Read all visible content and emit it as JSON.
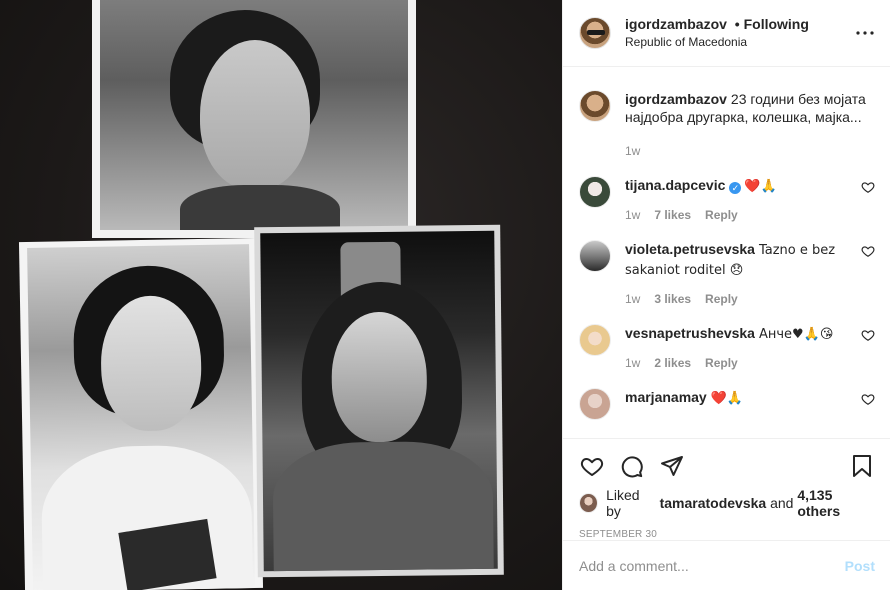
{
  "post": {
    "username": "igordzambazov",
    "follow_status": "• Following",
    "location": "Republic of Macedonia",
    "photo_alt": ""
  },
  "caption": {
    "username": "igordzambazov",
    "text": "23 години без мојата најдобра другарка, колешка, мајка...",
    "time": "1w"
  },
  "comments": [
    {
      "username": "tijana.dapcevic",
      "verified": true,
      "text": "❤️🙏",
      "time": "1w",
      "likes": "7 likes",
      "reply": "Reply"
    },
    {
      "username": "violeta.petrusevska",
      "verified": false,
      "text": "Tazno e bez sakaniot roditel 😞",
      "time": "1w",
      "likes": "3 likes",
      "reply": "Reply"
    },
    {
      "username": "vesnapetrushevska",
      "verified": false,
      "text": "Анче♥🙏😘",
      "time": "1w",
      "likes": "2 likes",
      "reply": "Reply"
    },
    {
      "username": "marjanamay",
      "verified": false,
      "text": "❤️🙏",
      "time": "",
      "likes": "",
      "reply": ""
    }
  ],
  "likes_line": {
    "prefix": "Liked by",
    "user": "tamaratodevska",
    "middle": "and",
    "others": "4,135 others"
  },
  "date": "September 30",
  "add_comment": {
    "placeholder": "Add a comment...",
    "post_label": "Post"
  },
  "icons": [
    "more-icon",
    "heart-icon",
    "comment-icon",
    "share-icon",
    "bookmark-icon",
    "verified-icon"
  ],
  "colors": {
    "link": "#b2dffc",
    "muted": "#8e8e8e",
    "verified": "#3897f0",
    "border": "#efefef"
  }
}
